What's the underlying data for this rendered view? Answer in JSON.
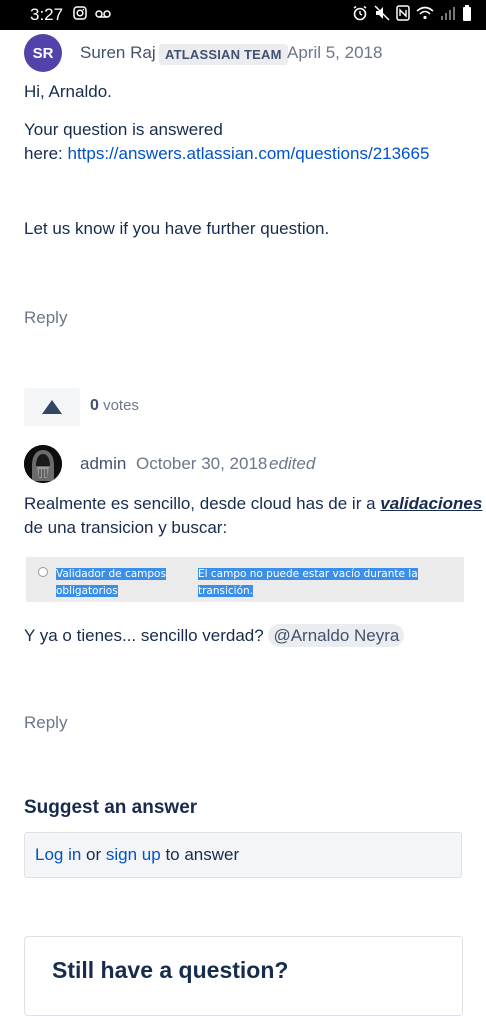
{
  "status_bar": {
    "time": "3:27"
  },
  "post1": {
    "avatar_initials": "SR",
    "author": "Suren Raj",
    "badge": "ATLASSIAN TEAM",
    "date": "April 5, 2018",
    "greeting": "Hi, Arnaldo.",
    "line1": "Your question is answered",
    "line2_prefix": "here: ",
    "link": "https://answers.atlassian.com/questions/213665",
    "line3": "Let us know if you have further question.",
    "reply": "Reply"
  },
  "votes": {
    "count": "0",
    "label": "votes"
  },
  "post2": {
    "author": "admin",
    "date": "October 30, 2018",
    "edited": "edited",
    "text_part1": "Realmente es sencillo, desde cloud has de ir a ",
    "text_emph": "validaciones",
    "text_part2": "de una transicion y buscar:",
    "embedded_col1_line1": "Validador de campos",
    "embedded_col1_line2": "obligatorios",
    "embedded_col2": "El campo no puede estar vacío durante la transición.",
    "text3": "Y ya o tienes... sencillo verdad? ",
    "mention": "@Arnaldo Neyra",
    "reply": "Reply"
  },
  "suggest": {
    "title": "Suggest an answer",
    "login": "Log in",
    "or": " or ",
    "signup": "sign up",
    "to_answer": " to answer"
  },
  "card": {
    "title": "Still have a question?"
  },
  "colors": {
    "link": "#0052cc",
    "text": "#172b4d",
    "muted": "#6b778c",
    "avatar": "#5243aa"
  }
}
